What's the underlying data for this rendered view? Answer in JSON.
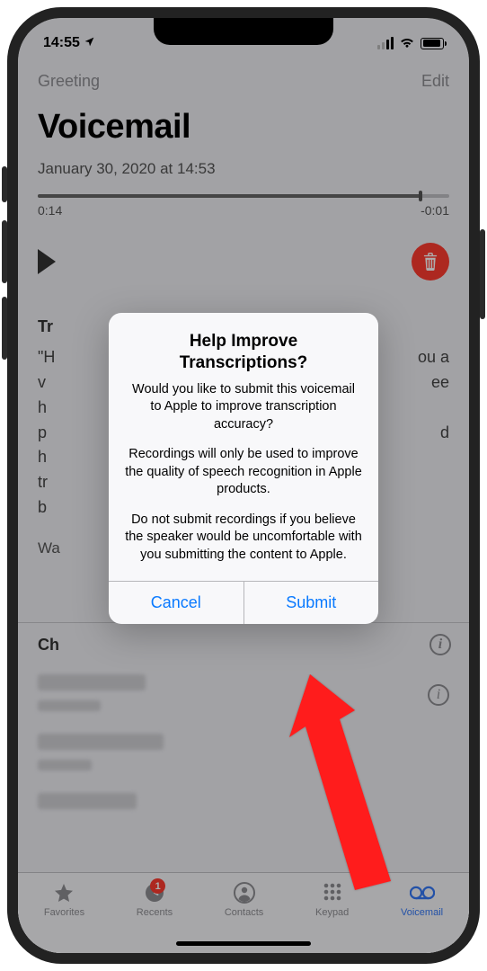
{
  "status": {
    "time": "14:55",
    "location_arrow": "➤"
  },
  "nav": {
    "left": "Greeting",
    "right": "Edit"
  },
  "header": {
    "title": "Voicemail",
    "timestamp": "January 30, 2020 at 14:53"
  },
  "player": {
    "elapsed": "0:14",
    "remaining": "-0:01"
  },
  "transcription": {
    "heading": "Tr",
    "quote_open": "\"H",
    "lines": [
      "v",
      "h",
      "p",
      "h",
      "tr",
      "b"
    ],
    "trail1": "ou a",
    "trail2": "ee",
    "trail3": "d"
  },
  "report": {
    "label": "Wa"
  },
  "choices": {
    "heading": "Ch"
  },
  "alert": {
    "title": "Help Improve Transcriptions?",
    "p1": "Would you like to submit this voicemail to Apple to improve transcription accuracy?",
    "p2": "Recordings will only be used to improve the quality of speech recognition in Apple products.",
    "p3": "Do not submit recordings if you believe the speaker would be uncomfortable with you submitting the content to Apple.",
    "cancel": "Cancel",
    "submit": "Submit"
  },
  "tabs": {
    "favorites": "Favorites",
    "recents": "Recents",
    "recents_badge": "1",
    "contacts": "Contacts",
    "keypad": "Keypad",
    "voicemail": "Voicemail"
  }
}
